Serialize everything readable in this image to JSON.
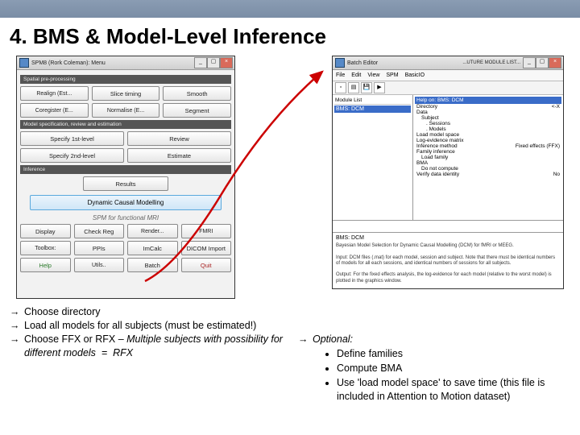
{
  "slide": {
    "title": "4. BMS & Model-Level Inference"
  },
  "spm": {
    "win_title": "SPM8 (Rork Coleman): Menu",
    "sec1": "Spatial pre-processing",
    "row1": [
      "Realign (Est...",
      "Slice timing",
      "Smooth"
    ],
    "row2": [
      "Coregister (E...",
      "Normalise (E...",
      "Segment"
    ],
    "sec2": "Model specification, review and estimation",
    "row3": [
      "Specify 1st-level",
      "Review"
    ],
    "row4": [
      "Specify 2nd-level",
      "Estimate"
    ],
    "sec3": "Inference",
    "row5": "Results",
    "big": "Dynamic Causal Modelling",
    "fn_label": "SPM for functional MRI",
    "row6": [
      "Display",
      "Check Reg",
      "Render...",
      "FMRI"
    ],
    "row7": [
      "Toolbox:",
      "PPIs",
      "ImCalc",
      "DICOM Import"
    ],
    "row8": [
      "Help",
      "Utils..",
      "Batch",
      "Quit"
    ]
  },
  "batch": {
    "win_title": "Batch Editor",
    "menu": [
      "File",
      "Edit",
      "View",
      "SPM",
      "BasicIO"
    ],
    "sep_title": "...UTURE MODULE LIST...",
    "module_head": "Module List",
    "module_item": "BMS: DCM",
    "right_head": "Help on: BMS: DCM",
    "tree": [
      {
        "l": "Directory",
        "v": ""
      },
      {
        "l": "Data",
        "v": ""
      },
      {
        "l": "Subject",
        "v": "",
        "indent": 1
      },
      {
        "l": ". Sessions",
        "v": "",
        "indent": 2
      },
      {
        "l": ". Models",
        "v": "",
        "indent": 2
      },
      {
        "l": "Load model space",
        "v": "",
        "indent": 0
      },
      {
        "l": "Log-evidence matrix",
        "v": "",
        "indent": 0
      },
      {
        "l": "Inference method",
        "v": "",
        "indent": 0
      },
      {
        "l": "Family inference",
        "v": "",
        "indent": 0
      },
      {
        "l": "Load family",
        "v": "",
        "indent": 1
      },
      {
        "l": "BMA",
        "v": "",
        "indent": 0
      },
      {
        "l": "Do not compute",
        "v": "",
        "indent": 1
      },
      {
        "l": "Verify data identity",
        "v": "No",
        "indent": 0
      }
    ],
    "tree_right": [
      "<-X",
      "",
      "",
      "",
      "",
      "",
      "",
      "",
      "",
      "",
      "",
      "",
      "No"
    ],
    "tree_right0": "Fixed effects (FFX)",
    "help_title": "BMS: DCM",
    "help1": "Bayesian Model Selection for Dynamic Causal Modelling (DCM) for fMRI or MEEG.",
    "help2": "Input: DCM files (.mat) for each model, session and subject. Note that there must be identical numbers of models for all each sessions, and identical numbers of sessions for all subjects.",
    "help3": "Output: For the fixed effects analysis, the log-evidence for each model (relative to the worst model) is plotted in the graphics window."
  },
  "instr": {
    "left": [
      "Choose directory",
      "Load all models for all subjects (must be estimated!)",
      "Choose FFX or RFX – Multiple subjects with possibility for different models  =  RFX"
    ],
    "right_head": "Optional:",
    "right_items": [
      "Define families",
      "Compute BMA",
      "Use 'load model space' to save time (this file is included in Attention to Motion dataset)"
    ]
  }
}
